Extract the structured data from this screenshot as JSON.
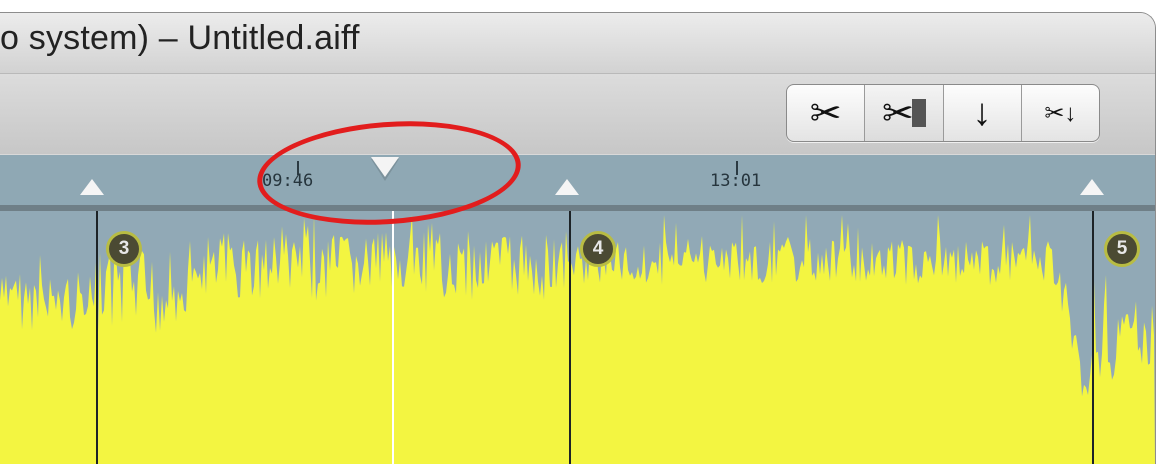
{
  "window": {
    "title": "o system) – Untitled.aiff"
  },
  "toolbar": {
    "tools": [
      {
        "name": "scissors-icon",
        "glyph": "✂"
      },
      {
        "name": "scissors-active-icon",
        "glyph": "✂"
      },
      {
        "name": "arrow-down-icon",
        "glyph": "↓"
      },
      {
        "name": "split-arrow-icon",
        "glyph": "✂↓"
      }
    ]
  },
  "ruler": {
    "times": [
      "09:46",
      "13:01"
    ]
  },
  "regions": [
    "3",
    "4",
    "5"
  ],
  "colors": {
    "waveform": "#f3f541",
    "track_bg": "#91a9b6",
    "annotation": "#e21d1d"
  }
}
